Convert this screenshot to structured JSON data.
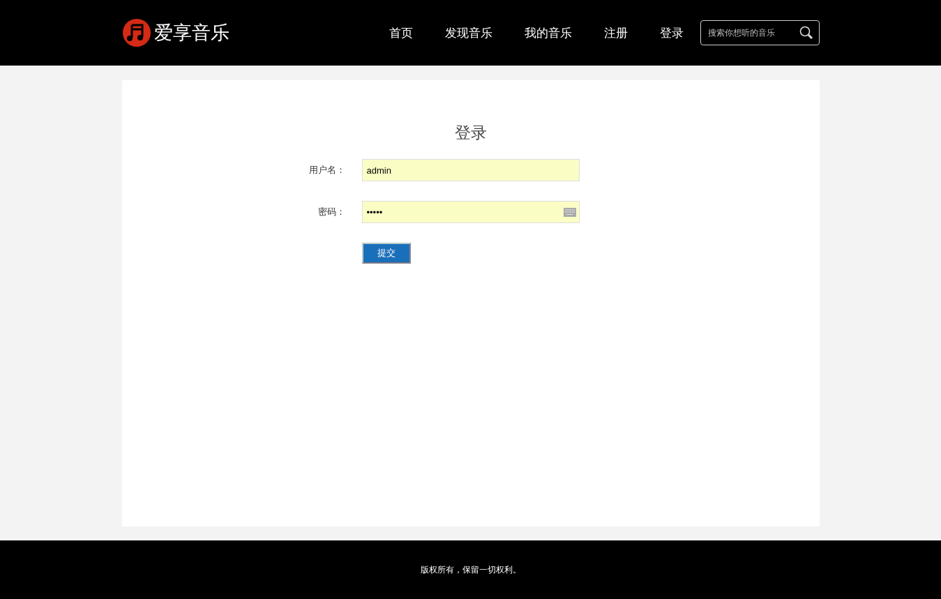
{
  "header": {
    "logo_text": "爱享音乐",
    "nav": [
      {
        "label": "首页"
      },
      {
        "label": "发现音乐"
      },
      {
        "label": "我的音乐"
      },
      {
        "label": "注册"
      },
      {
        "label": "登录"
      }
    ],
    "search": {
      "placeholder": "搜索你想听的音乐"
    }
  },
  "login_form": {
    "title": "登录",
    "fields": [
      {
        "label": "用户名：",
        "value": "admin",
        "kind": "text"
      },
      {
        "label": "密码：",
        "value": "•••••",
        "kind": "password"
      }
    ],
    "submit": "提交"
  },
  "footer": {
    "text": "版权所有，保留一切权利。"
  }
}
